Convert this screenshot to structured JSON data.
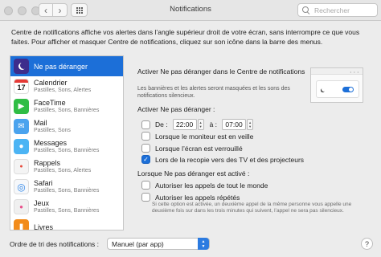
{
  "window": {
    "title": "Notifications"
  },
  "search": {
    "placeholder": "Rechercher"
  },
  "description": "Centre de notifications affiche vos alertes dans l’angle supérieur droit de votre écran, sans interrompre ce que vous faites. Pour afficher et masquer Centre de notifications, cliquez sur son icône dans la barre des menus.",
  "apps": [
    {
      "name": "Ne pas déranger",
      "sub": "",
      "icon": "moon-icon",
      "selected": true
    },
    {
      "name": "Calendrier",
      "sub": "Pastilles, Sons, Alertes",
      "icon": "calendar-icon",
      "badge": "17"
    },
    {
      "name": "FaceTime",
      "sub": "Pastilles, Sons, Bannières",
      "icon": "facetime-icon"
    },
    {
      "name": "Mail",
      "sub": "Pastilles, Sons",
      "icon": "mail-icon"
    },
    {
      "name": "Messages",
      "sub": "Pastilles, Sons, Bannières",
      "icon": "messages-icon"
    },
    {
      "name": "Rappels",
      "sub": "Pastilles, Sons, Alertes",
      "icon": "reminders-icon"
    },
    {
      "name": "Safari",
      "sub": "Pastilles, Sons, Bannières",
      "icon": "safari-icon"
    },
    {
      "name": "Jeux",
      "sub": "Pastilles, Sons, Bannières",
      "icon": "game-center-icon"
    },
    {
      "name": "Livres",
      "sub": "",
      "icon": "books-icon"
    }
  ],
  "dnd": {
    "heading": "Activer Ne pas déranger dans le Centre de notifications",
    "explain": "Les bannières et les alertes seront masquées et les sons des notifications silencieux.",
    "activate_label": "Activer Ne pas déranger :",
    "schedule": {
      "from_label": "De :",
      "from": "22:00",
      "to_label": "à :",
      "to": "07:00",
      "checked": false
    },
    "options": [
      {
        "label": "Lorsque le moniteur est en veille",
        "checked": false
      },
      {
        "label": "Lorsque l’écran est verrouillé",
        "checked": false
      },
      {
        "label": "Lors de la recopie vers des TV et des projecteurs",
        "checked": true
      }
    ],
    "when_label": "Lorsque Ne pas déranger est activé :",
    "allow": [
      {
        "label": "Autoriser les appels de tout le monde",
        "checked": false
      },
      {
        "label": "Autoriser les appels répétés",
        "checked": false
      }
    ],
    "note": "Si cette option est activée, un deuxième appel de la même personne vous appelle une deuxième fois sur dans les trois minutes qui suivent, l’appel ne sera pas silencieux."
  },
  "footer": {
    "sort_label": "Ordre de tri des notifications :",
    "sort_value": "Manuel (par app)",
    "help": "?"
  }
}
